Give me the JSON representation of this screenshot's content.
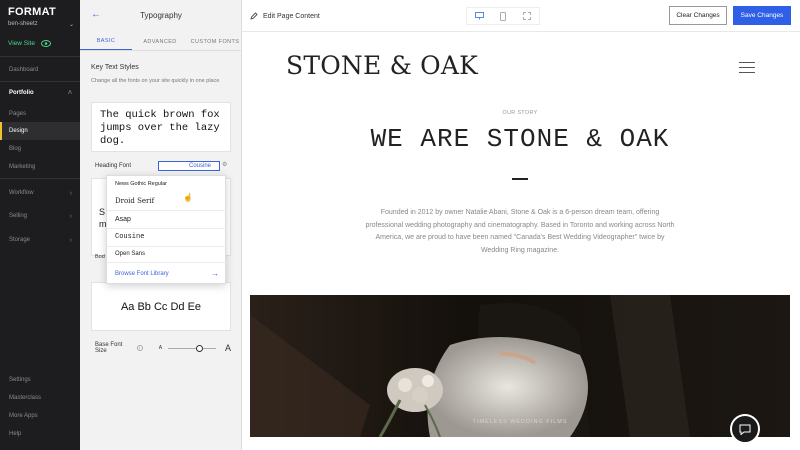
{
  "nav": {
    "logo": "FORMAT",
    "account": "ben-sheetz",
    "view_site": "View Site",
    "items": [
      {
        "label": "Dashboard"
      },
      {
        "label": "Portfolio"
      },
      {
        "label": "Pages"
      },
      {
        "label": "Design"
      },
      {
        "label": "Blog"
      },
      {
        "label": "Marketing"
      },
      {
        "label": "Workflow"
      },
      {
        "label": "Selling"
      },
      {
        "label": "Storage"
      }
    ],
    "bottom": [
      {
        "label": "Settings"
      },
      {
        "label": "Masterclass"
      },
      {
        "label": "More Apps"
      },
      {
        "label": "Help"
      }
    ]
  },
  "panel": {
    "title": "Typography",
    "tabs": [
      "BASIC",
      "ADVANCED",
      "CUSTOM FONTS"
    ],
    "section_title": "Key Text Styles",
    "section_desc": "Change all the fonts on your site quickly in one place",
    "sample_text": "The quick brown fox jumps over the lazy dog.",
    "heading_font_label": "Heading Font",
    "heading_font_value": "Cousine",
    "partial_s": "S",
    "partial_m": "m",
    "body_label_partial": "Bod",
    "sample_letters": "Aa Bb Cc Dd Ee",
    "base_font_size_label": "Base Font Size",
    "size_small": "A",
    "size_large": "A",
    "base_font_size_value": 0.65
  },
  "dropdown": {
    "options": [
      "News Gothic Regular",
      "Droid Serif",
      "Asap",
      "Cousine",
      "Open Sans"
    ],
    "browse": "Browse Font Library"
  },
  "toolbar": {
    "edit_label": "Edit Page Content",
    "clear_label": "Clear Changes",
    "save_label": "Save Changes",
    "accent": "#2e5fe6"
  },
  "site": {
    "logo": "STONE & OAK",
    "eyebrow": "OUR STORY",
    "headline": "WE ARE STONE & OAK",
    "paragraph": "Founded in 2012 by owner Natalie Abani, Stone & Oak is a 6-person dream team, offering professional wedding photography and cinematography. Based in Toronto and working across North America, we are proud to have been named \"Canada's Best Wedding Videographer\" twice by Wedding Ring magazine.",
    "photo_caption": "TIMELESS WEDDING FILMS"
  }
}
